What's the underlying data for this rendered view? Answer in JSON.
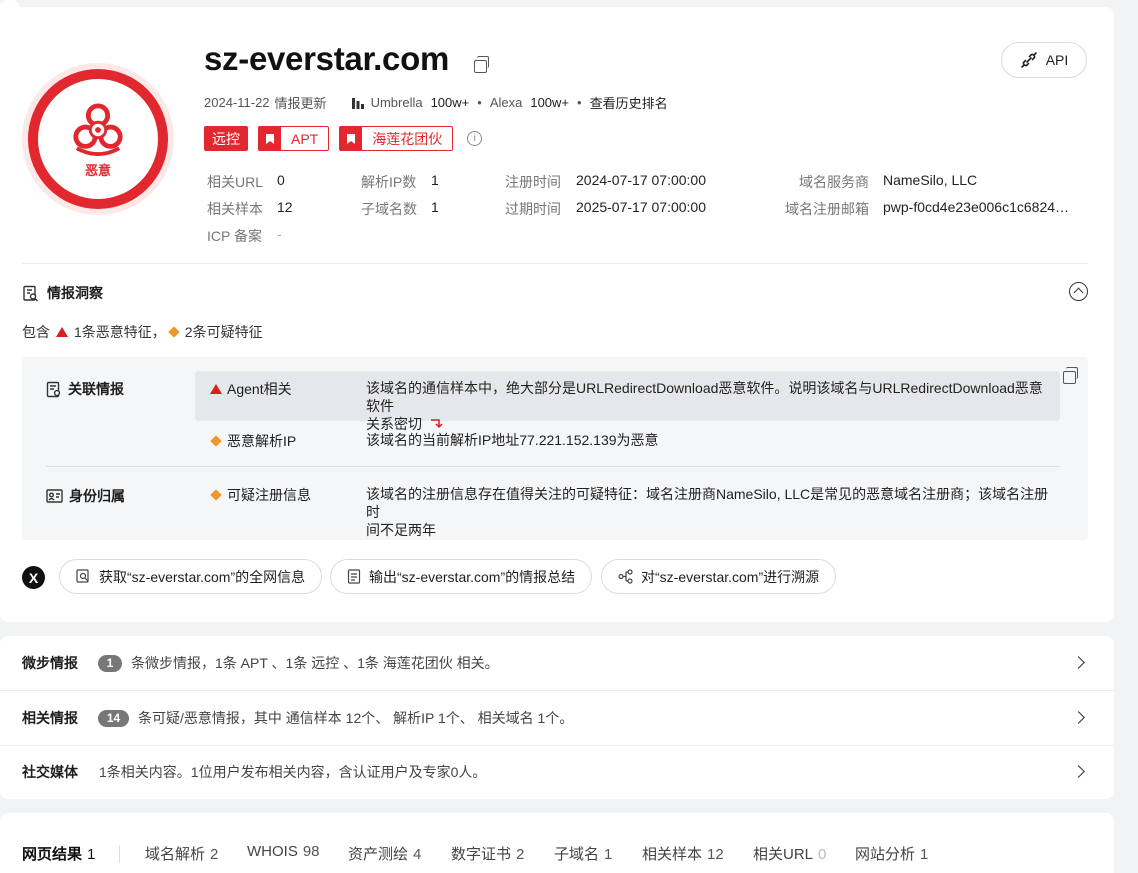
{
  "header": {
    "domain": "sz-everstar.com",
    "logo_label": "恶意",
    "api_label": "API",
    "update_date": "2024-11-22",
    "update_label": "情报更新",
    "umbrella_label": "Umbrella",
    "umbrella_rank": "100w+",
    "alexa_label": "Alexa",
    "alexa_rank": "100w+",
    "history_link": "查看历史排名",
    "tags": [
      {
        "label": "远控",
        "style": "solid"
      },
      {
        "label": "APT",
        "style": "outline"
      },
      {
        "label": "海莲花团伙",
        "style": "outline"
      }
    ],
    "tag_color": "#e0282e"
  },
  "info": {
    "related_url_label": "相关URL",
    "related_url_value": "0",
    "related_sample_label": "相关样本",
    "related_sample_value": "12",
    "icp_label": "ICP 备案",
    "icp_value": "-",
    "resolve_ip_label": "解析IP数",
    "resolve_ip_value": "1",
    "subdomain_label": "子域名数",
    "subdomain_value": "1",
    "reg_time_label": "注册时间",
    "reg_time_value": "2024-07-17 07:00:00",
    "exp_time_label": "过期时间",
    "exp_time_value": "2025-07-17 07:00:00",
    "registrar_label": "域名服务商",
    "registrar_value": "NameSilo, LLC",
    "reg_email_label": "域名注册邮箱",
    "reg_email_value": "pwp-f0cd4e23e006c1c6824…"
  },
  "insight": {
    "title": "情报洞察",
    "contains_prefix": "包含",
    "malicious_count": "1条恶意特征，",
    "suspicious_count": "2条可疑特征",
    "categories": [
      {
        "name": "关联情报",
        "items": [
          {
            "level": "malicious",
            "label": "Agent相关",
            "desc_line1": "该域名的通信样本中，绝大部分是URLRedirectDownload恶意软件。说明该域名与URLRedirectDownload恶意软件",
            "desc_line2": "关系密切"
          },
          {
            "level": "suspicious",
            "label": "恶意解析IP",
            "desc_line1": "该域名的当前解析IP地址77.221.152.139为恶意",
            "desc_line2": ""
          }
        ]
      },
      {
        "name": "身份归属",
        "items": [
          {
            "level": "suspicious",
            "label": "可疑注册信息",
            "desc_line1": "该域名的注册信息存在值得关注的可疑特征：域名注册商NameSilo, LLC是常见的恶意域名注册商；该域名注册时",
            "desc_line2": "间不足两年"
          }
        ]
      }
    ]
  },
  "actions": [
    {
      "label": "获取“sz-everstar.com”的全网信息"
    },
    {
      "label": "输出“sz-everstar.com”的情报总结"
    },
    {
      "label": "对“sz-everstar.com”进行溯源"
    }
  ],
  "summary": [
    {
      "title": "微步情报",
      "badge": "1",
      "text": "条微步情报，1条 APT 、1条 远控 、1条 海莲花团伙 相关。"
    },
    {
      "title": "相关情报",
      "badge": "14",
      "text": "条可疑/恶意情报，其中 通信样本 12个、 解析IP 1个、 相关域名 1个。"
    },
    {
      "title": "社交媒体",
      "badge": "",
      "text": "1条相关内容。1位用户发布相关内容，含认证用户及专家0人。"
    }
  ],
  "tabs": [
    {
      "label": "网页结果",
      "count": "1"
    },
    {
      "label": "域名解析",
      "count": "2"
    },
    {
      "label": "WHOIS",
      "count": "98"
    },
    {
      "label": "资产测绘",
      "count": "4"
    },
    {
      "label": "数字证书",
      "count": "2"
    },
    {
      "label": "子域名",
      "count": "1"
    },
    {
      "label": "相关样本",
      "count": "12"
    },
    {
      "label": "相关URL",
      "count": "0"
    },
    {
      "label": "网站分析",
      "count": "1"
    }
  ]
}
